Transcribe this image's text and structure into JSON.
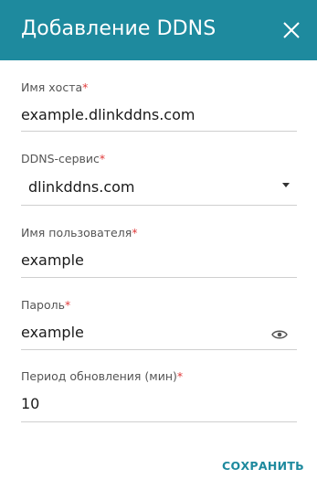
{
  "dialog": {
    "title": "Добавление DDNS",
    "close_icon": "close-icon",
    "accent_color": "#1e8a9e",
    "required_color": "#e03a3a"
  },
  "fields": {
    "hostname": {
      "label": "Имя хоста",
      "required_mark": "*",
      "value": "example.dlinkddns.com"
    },
    "service": {
      "label": "DDNS-сервис",
      "required_mark": "*",
      "value": "dlinkddns.com",
      "icon": "dropdown-arrow-icon"
    },
    "username": {
      "label": "Имя пользователя",
      "required_mark": "*",
      "value": "example"
    },
    "password": {
      "label": "Пароль",
      "required_mark": "*",
      "value": "example",
      "icon": "eye-icon"
    },
    "period": {
      "label": "Период обновления (мин)",
      "required_mark": "*",
      "value": "10"
    }
  },
  "actions": {
    "save_label": "СОХРАНИТЬ"
  }
}
